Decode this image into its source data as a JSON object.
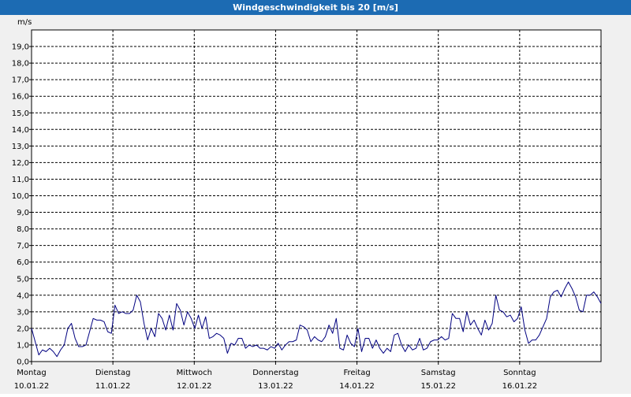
{
  "window": {
    "title": "Windgeschwindigkeit bis 20 [m/s]"
  },
  "chart_data": {
    "type": "line",
    "title": "Windgeschwindigkeit bis 20 [m/s]",
    "ylabel": "m/s",
    "ylim": [
      0,
      20
    ],
    "xlim": [
      0,
      7
    ],
    "y_ticks": [
      "0,0",
      "1,0",
      "2,0",
      "3,0",
      "4,0",
      "5,0",
      "6,0",
      "7,0",
      "8,0",
      "9,0",
      "10,0",
      "11,0",
      "12,0",
      "13,0",
      "14,0",
      "15,0",
      "16,0",
      "17,0",
      "18,0",
      "19,0"
    ],
    "x_ticks": [
      {
        "day": "Montag",
        "date": "10.01.22"
      },
      {
        "day": "Dienstag",
        "date": "11.01.22"
      },
      {
        "day": "Mittwoch",
        "date": "12.01.22"
      },
      {
        "day": "Donnerstag",
        "date": "13.01.22"
      },
      {
        "day": "Freitag",
        "date": "14.01.22"
      },
      {
        "day": "Samstag",
        "date": "15.01.22"
      },
      {
        "day": "Sonntag",
        "date": "16.01.22"
      }
    ],
    "grid": true,
    "line_color": "#000080",
    "series": [
      {
        "values": [
          2.0,
          1.2,
          0.4,
          0.7,
          0.6,
          0.8,
          0.6,
          0.3,
          0.7,
          1.0,
          2.0,
          2.3,
          1.4,
          0.9,
          0.9,
          1.0,
          1.8,
          2.6,
          2.5,
          2.5,
          2.4,
          1.8,
          1.7,
          3.4,
          2.9,
          3.0,
          2.9,
          2.9,
          3.1,
          4.0,
          3.6,
          2.3,
          1.3,
          2.0,
          1.5,
          2.9,
          2.6,
          1.9,
          2.8,
          1.9,
          3.5,
          3.1,
          2.2,
          3.0,
          2.6,
          2.0,
          2.8,
          2.0,
          2.7,
          1.4,
          1.5,
          1.7,
          1.6,
          1.4,
          0.5,
          1.1,
          1.0,
          1.4,
          1.4,
          0.8,
          1.0,
          0.9,
          1.0,
          0.8,
          0.8,
          0.7,
          0.9,
          0.8,
          1.1,
          0.7,
          1.0,
          1.2,
          1.2,
          1.3,
          2.2,
          2.1,
          1.9,
          1.2,
          1.5,
          1.3,
          1.2,
          1.5,
          2.2,
          1.7,
          2.6,
          0.8,
          0.7,
          1.6,
          1.1,
          0.9,
          2.0,
          0.6,
          1.4,
          1.4,
          0.8,
          1.3,
          0.8,
          0.5,
          0.8,
          0.6,
          1.6,
          1.7,
          1.0,
          0.6,
          1.0,
          0.7,
          0.8,
          1.4,
          0.7,
          0.8,
          1.2,
          1.3,
          1.3,
          1.5,
          1.3,
          1.4,
          2.9,
          2.6,
          2.6,
          1.8,
          3.0,
          2.2,
          2.5,
          2.0,
          1.6,
          2.5,
          1.9,
          2.3,
          4.0,
          3.1,
          3.0,
          2.7,
          2.8,
          2.4,
          2.6,
          3.3,
          1.9,
          1.1,
          1.3,
          1.3,
          1.6,
          2.1,
          2.6,
          3.9,
          4.2,
          4.3,
          3.9,
          4.4,
          4.8,
          4.4,
          3.9,
          3.1,
          3.0,
          4.0,
          4.0,
          4.2,
          3.9,
          3.5
        ]
      }
    ]
  }
}
